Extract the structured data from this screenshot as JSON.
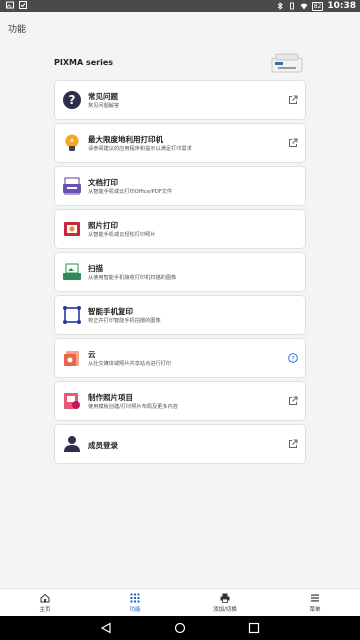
{
  "status_bar": {
    "time": "10:38",
    "battery": "82"
  },
  "page_title": "功能",
  "series_label": "PIXMA series",
  "cards": [
    {
      "title": "常见问题",
      "subtitle": "常见问题解答",
      "action_icon": "external-link-icon"
    },
    {
      "title": "最大限度地利用打印机",
      "subtitle": "请参阅建议的应用程序和提示以满足打印需求",
      "action_icon": "external-link-icon"
    },
    {
      "title": "文档打印",
      "subtitle": "从智能手机或云打印Office/PDF文件",
      "action_icon": ""
    },
    {
      "title": "照片打印",
      "subtitle": "从智能手机或云轻松打印照片",
      "action_icon": ""
    },
    {
      "title": "扫描",
      "subtitle": "从使用智能手机接收打印机扫描的图像",
      "action_icon": ""
    },
    {
      "title": "智能手机复印",
      "subtitle": "校正并打印智能手机拍摄的图像",
      "action_icon": ""
    },
    {
      "title": "云",
      "subtitle": "从社交媒体或照片共享站点进行打印",
      "action_icon": "help-icon"
    },
    {
      "title": "制作照片项目",
      "subtitle": "使用模板创建/打印照片布局及更多内容",
      "action_icon": "external-link-icon"
    },
    {
      "title": "成员登录",
      "subtitle": "",
      "action_icon": "external-link-icon"
    }
  ],
  "nav": [
    {
      "label": "主页",
      "icon": "home-icon"
    },
    {
      "label": "功能",
      "icon": "grid-icon",
      "active": true
    },
    {
      "label": "添加/切换",
      "icon": "printer-icon"
    },
    {
      "label": "菜单",
      "icon": "menu-icon"
    }
  ],
  "colors": {
    "accent": "#1565c0",
    "status_bar": "#4a4a4a",
    "link_icon": "#666666"
  }
}
